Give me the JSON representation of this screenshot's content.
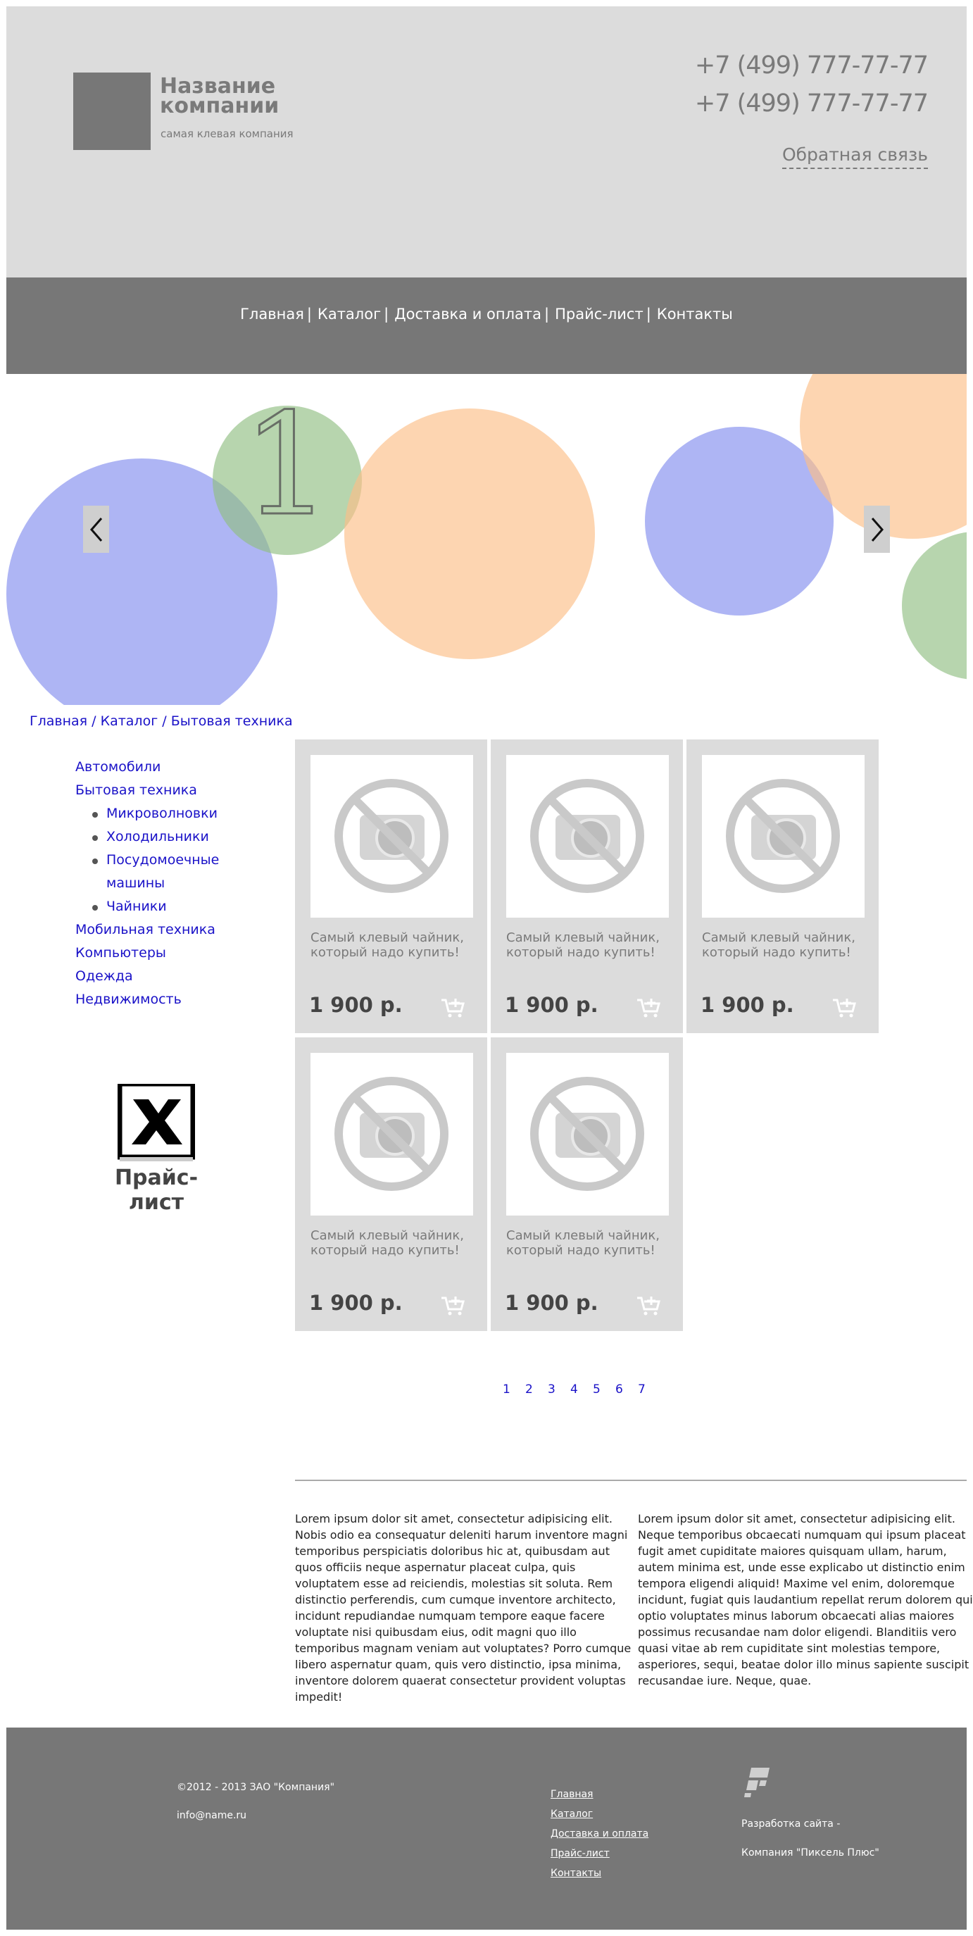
{
  "header": {
    "company_name": "Название компании",
    "tagline": "самая клевая компания",
    "phone_1": "+7 (499) 777-77-77",
    "phone_2": "+7 (499) 777-77-77",
    "feedback_label": "Обратная связь"
  },
  "nav": {
    "items": [
      {
        "label": "Главная"
      },
      {
        "label": "Каталог"
      },
      {
        "label": "Доставка и оплата"
      },
      {
        "label": "Прайс-лист"
      },
      {
        "label": "Контакты"
      }
    ],
    "separator": "|"
  },
  "slider": {
    "slide_number": "1",
    "colors": {
      "blue": "#aab2f2",
      "green": "#b6d3ad",
      "orange": "#fdd3ad"
    }
  },
  "breadcrumb": {
    "items": [
      "Главная",
      "Каталог",
      "Бытовая техника"
    ],
    "separator": "/"
  },
  "sidebar": {
    "categories": [
      {
        "label": "Автомобили"
      },
      {
        "label": "Бытовая техника"
      },
      {
        "label": "Мобильная техника"
      },
      {
        "label": "Компьютеры"
      },
      {
        "label": "Одежда"
      },
      {
        "label": "Недвижимость"
      }
    ],
    "subcategories": [
      {
        "label": "Микроволновки"
      },
      {
        "label": "Холодильники"
      },
      {
        "label": "Посудомоечные машины"
      },
      {
        "label": "Чайники"
      }
    ],
    "price_list_label": "Прайс-лист"
  },
  "products": [
    {
      "title": "Самый клевый чайник, который надо купить!",
      "price": "1 900 р."
    },
    {
      "title": "Самый клевый чайник, который надо купить!",
      "price": "1 900 р."
    },
    {
      "title": "Самый клевый чайник, который надо купить!",
      "price": "1 900 р."
    },
    {
      "title": "Самый клевый чайник, который надо купить!",
      "price": "1 900 р."
    },
    {
      "title": "Самый клевый чайник, который надо купить!",
      "price": "1 900 р."
    }
  ],
  "pagination": [
    "1",
    "2",
    "3",
    "4",
    "5",
    "6",
    "7"
  ],
  "text_columns": [
    "Lorem ipsum dolor sit amet, consectetur adipisicing elit. Nobis odio ea consequatur deleniti harum inventore magni temporibus perspiciatis doloribus hic at, quibusdam aut quos officiis neque aspernatur placeat culpa, quis voluptatem esse ad reiciendis, molestias sit soluta. Rem distinctio perferendis, cum cumque inventore architecto, incidunt repudiandae numquam tempore eaque facere voluptate nisi quibusdam eius, odit magni quo illo temporibus magnam veniam aut voluptates? Porro cumque libero aspernatur quam, quis vero distinctio, ipsa minima, inventore dolorem quaerat consectetur provident voluptas impedit!",
    "Lorem ipsum dolor sit amet, consectetur adipisicing elit. Neque temporibus obcaecati numquam qui ipsum placeat fugit amet cupiditate maiores quisquam ullam, harum, autem minima est, unde esse explicabo ut distinctio enim tempora eligendi aliquid! Maxime vel enim, doloremque incidunt, fugiat quis laudantium repellat rerum dolorem qui optio voluptates minus laborum obcaecati alias maiores possimus recusandae nam dolor eligendi. Blanditiis vero quasi vitae ab rem cupiditate sint molestias tempore, asperiores, sequi, beatae dolor illo minus sapiente suscipit recusandae iure. Neque, quae."
  ],
  "footer": {
    "copyright": "©2012 - 2013 ЗАО \"Компания\"",
    "email": "info@name.ru",
    "links": [
      "Главная",
      "Каталог",
      "Доставка и оплата",
      "Прайс-лист",
      "Контакты"
    ],
    "developer_line_1": "Разработка сайта -",
    "developer_line_2": "Компания \"Пиксель Плюс\""
  },
  "colors": {
    "header_bg": "#dcdcdc",
    "nav_bg": "#777777",
    "link": "#1a12c8",
    "card_bg": "#dcdcdc"
  }
}
